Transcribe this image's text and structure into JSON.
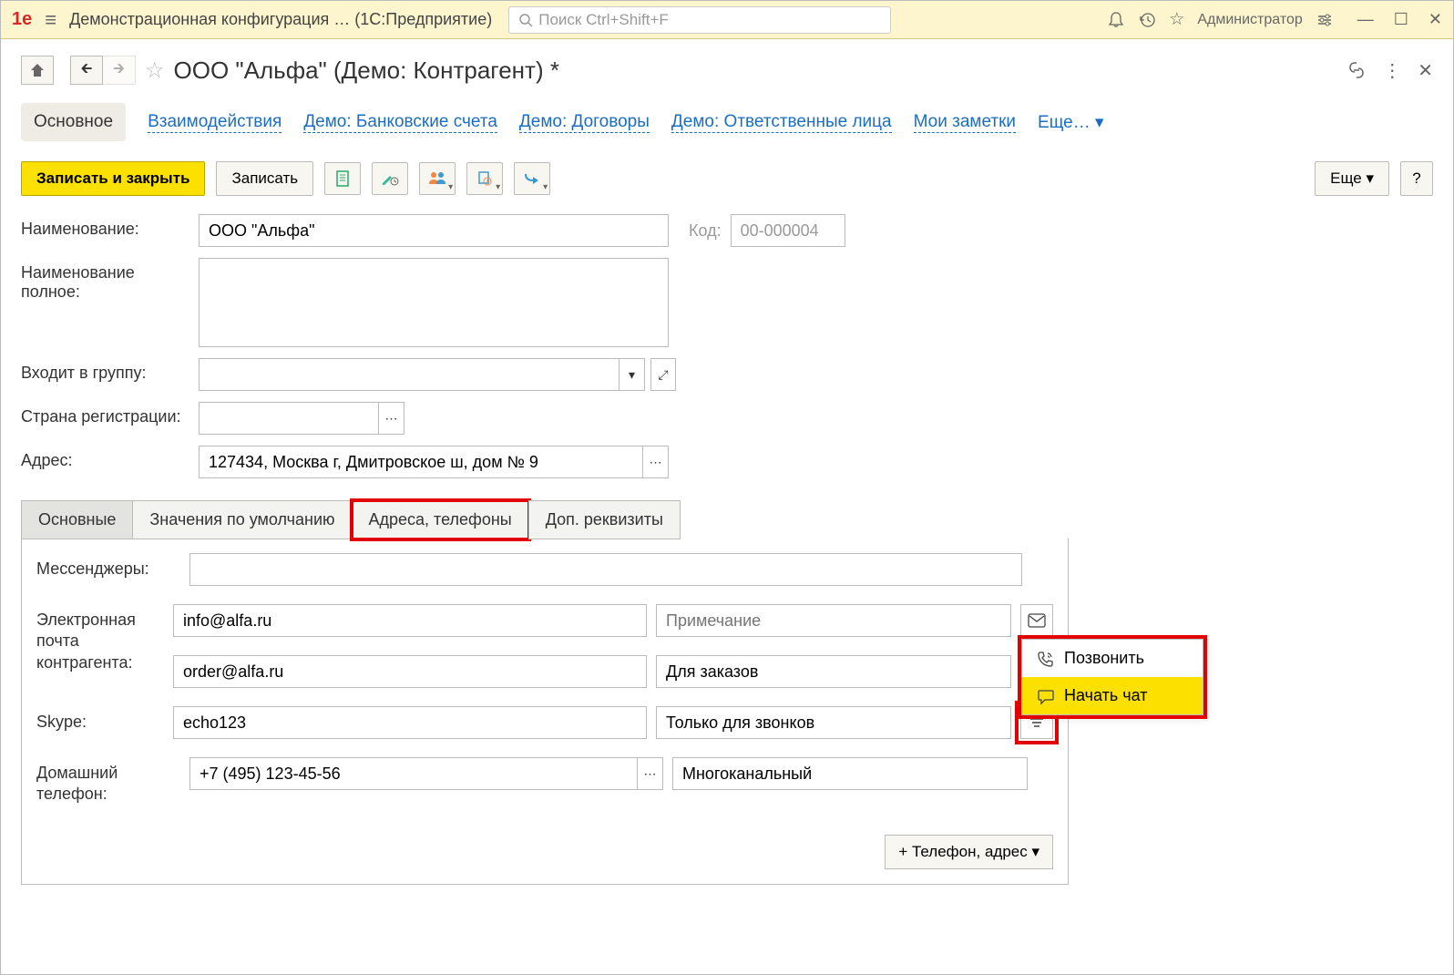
{
  "topbar": {
    "app_title": "Демонстрационная конфигурация …   (1С:Предприятие)",
    "search_placeholder": "Поиск Ctrl+Shift+F",
    "username": "Администратор"
  },
  "form": {
    "title": "ООО \"Альфа\" (Демо: Контрагент) *"
  },
  "sections": {
    "main": "Основное",
    "interactions": "Взаимодействия",
    "bank": "Демо: Банковские счета",
    "contracts": "Демо: Договоры",
    "responsible": "Демо: Ответственные лица",
    "notes": "Мои заметки",
    "more": "Еще… ▾"
  },
  "toolbar": {
    "save_close": "Записать и закрыть",
    "save": "Записать",
    "more": "Еще ▾",
    "help": "?"
  },
  "fields": {
    "name_label": "Наименование:",
    "name_value": "ООО \"Альфа\"",
    "code_label": "Код:",
    "code_value": "00-000004",
    "fullname_label": "Наименование полное:",
    "fullname_value": "",
    "group_label": "Входит в группу:",
    "group_value": "",
    "country_label": "Страна регистрации:",
    "country_value": "",
    "address_label": "Адрес:",
    "address_value": "127434, Москва г, Дмитровское ш, дом № 9"
  },
  "detail_tabs": {
    "main": "Основные",
    "defaults": "Значения по умолчанию",
    "addrphones": "Адреса, телефоны",
    "extra": "Доп. реквизиты"
  },
  "contacts": {
    "messengers_label": "Мессенджеры:",
    "email_label": "Электронная почта контрагента:",
    "email1": "info@alfa.ru",
    "email1_note_placeholder": "Примечание",
    "email2": "order@alfa.ru",
    "email2_note": "Для заказов",
    "skype_label": "Skype:",
    "skype_value": "echo123",
    "skype_note": "Только для звонков",
    "phone_label": "Домашний телефон:",
    "phone_value": "+7 (495) 123-45-56",
    "phone_note": "Многоканальный",
    "add_btn": "+ Телефон, адрес  ▾"
  },
  "popup": {
    "call": "Позвонить",
    "chat": "Начать чат"
  }
}
